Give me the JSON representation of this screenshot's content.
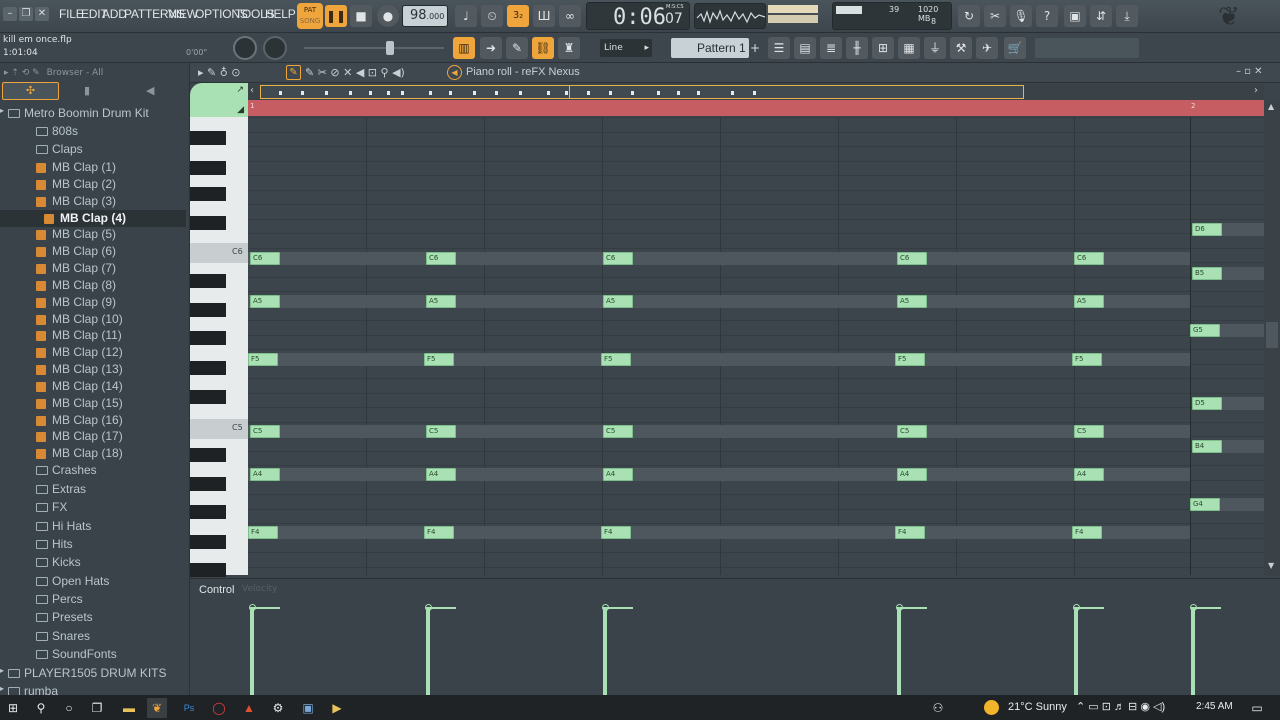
{
  "menu": [
    "FILE",
    "EDIT",
    "ADD",
    "PATTERNS",
    "VIEW",
    "OPTIONS",
    "TOOLS",
    "HELP"
  ],
  "transport": {
    "pat_label": "PAT",
    "song_label": "SONG",
    "tempo": "98",
    "tempo_dec": ".000",
    "time_main": "0:06",
    "time_sub": "07",
    "time_unit": "M:S:CS"
  },
  "monitor": {
    "cpu": "39",
    "ram": "1020 MB",
    "poly": "8"
  },
  "project": {
    "file": "kill em once.flp",
    "position": "1:01:04",
    "elapsed": "0'00\""
  },
  "snap": {
    "mode": "Line"
  },
  "pattern": {
    "name": "Pattern 1",
    "add": "+"
  },
  "browser": {
    "header": "Browser - All",
    "items": [
      {
        "label": "Metro Boomin Drum Kit",
        "type": "folder",
        "level": 0
      },
      {
        "label": "808s",
        "type": "folder",
        "level": 1
      },
      {
        "label": "Claps",
        "type": "folder",
        "level": 1
      },
      {
        "label": "MB Clap (1)",
        "type": "clip",
        "level": 2
      },
      {
        "label": "MB Clap (2)",
        "type": "clip",
        "level": 2
      },
      {
        "label": "MB Clap (3)",
        "type": "clip",
        "level": 2
      },
      {
        "label": "MB Clap (4)",
        "type": "clip",
        "level": 2,
        "selected": true
      },
      {
        "label": "MB Clap (5)",
        "type": "clip",
        "level": 2
      },
      {
        "label": "MB Clap (6)",
        "type": "clip",
        "level": 2
      },
      {
        "label": "MB Clap (7)",
        "type": "clip",
        "level": 2
      },
      {
        "label": "MB Clap (8)",
        "type": "clip",
        "level": 2
      },
      {
        "label": "MB Clap (9)",
        "type": "clip",
        "level": 2
      },
      {
        "label": "MB Clap (10)",
        "type": "clip",
        "level": 2
      },
      {
        "label": "MB Clap (11)",
        "type": "clip",
        "level": 2
      },
      {
        "label": "MB Clap (12)",
        "type": "clip",
        "level": 2
      },
      {
        "label": "MB Clap (13)",
        "type": "clip",
        "level": 2
      },
      {
        "label": "MB Clap (14)",
        "type": "clip",
        "level": 2
      },
      {
        "label": "MB Clap (15)",
        "type": "clip",
        "level": 2
      },
      {
        "label": "MB Clap (16)",
        "type": "clip",
        "level": 2
      },
      {
        "label": "MB Clap (17)",
        "type": "clip",
        "level": 2
      },
      {
        "label": "MB Clap (18)",
        "type": "clip",
        "level": 2
      },
      {
        "label": "Crashes",
        "type": "folder",
        "level": 1
      },
      {
        "label": "Extras",
        "type": "folder",
        "level": 1
      },
      {
        "label": "FX",
        "type": "folder",
        "level": 1
      },
      {
        "label": "Hi Hats",
        "type": "folder",
        "level": 1
      },
      {
        "label": "Hits",
        "type": "folder",
        "level": 1
      },
      {
        "label": "Kicks",
        "type": "folder",
        "level": 1
      },
      {
        "label": "Open Hats",
        "type": "folder",
        "level": 1
      },
      {
        "label": "Percs",
        "type": "folder",
        "level": 1
      },
      {
        "label": "Presets",
        "type": "folder",
        "level": 1
      },
      {
        "label": "Snares",
        "type": "folder",
        "level": 1
      },
      {
        "label": "SoundFonts",
        "type": "folder",
        "level": 1
      },
      {
        "label": "PLAYER1505 DRUM KITS",
        "type": "folder",
        "level": 0
      },
      {
        "label": "rumba",
        "type": "folder",
        "level": 0
      }
    ]
  },
  "pianoroll": {
    "title": "Piano roll - reFX Nexus",
    "bar1": "1",
    "bar2": "2",
    "key_labels": {
      "c6": "C6",
      "c5": "C5"
    },
    "control_label": "Control",
    "control_target": "Velocity",
    "notes": [
      "C6",
      "A5",
      "F5",
      "C5",
      "A4",
      "F4"
    ],
    "notes2": [
      "D6",
      "B5",
      "G5",
      "D5",
      "B4",
      "G4"
    ]
  },
  "taskbar": {
    "weather": "21°C  Sunny",
    "time": "2:45 AM"
  }
}
